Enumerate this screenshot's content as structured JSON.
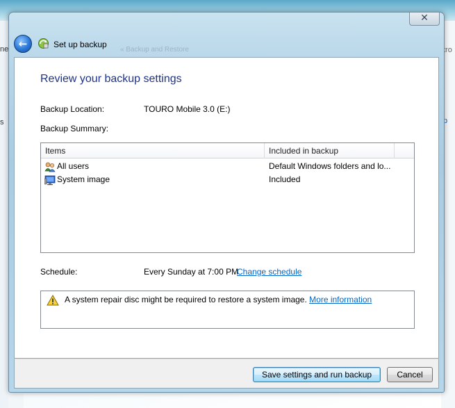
{
  "background": {
    "left_fragments": [
      "ne",
      "s"
    ],
    "right_fragments": [
      "tro",
      "p"
    ]
  },
  "window": {
    "close_glyph": "✕",
    "back_glyph": "←",
    "title": "Set up backup",
    "ghost_breadcrumb": "«  Backup and Restore"
  },
  "content": {
    "heading": "Review your backup settings",
    "backup_location_label": "Backup Location:",
    "backup_location_value": "TOURO Mobile 3.0 (E:)",
    "backup_summary_label": "Backup Summary:",
    "table": {
      "columns": [
        "Items",
        "Included in backup"
      ],
      "rows": [
        {
          "icon": "users-icon",
          "item": "All users",
          "included": "Default Windows folders and lo..."
        },
        {
          "icon": "system-image-icon",
          "item": "System image",
          "included": "Included"
        }
      ]
    },
    "schedule_label": "Schedule:",
    "schedule_value": "Every Sunday at 7:00 PM",
    "change_schedule_link": "Change schedule",
    "warning": {
      "icon": "warning-icon",
      "text": "A system repair disc might be required to restore a system image.",
      "link": "More information"
    }
  },
  "footer": {
    "save_button": "Save settings and run backup",
    "cancel_button": "Cancel"
  },
  "colors": {
    "heading": "#1e3287",
    "link": "#0066cc",
    "frame": "#a9cce2"
  }
}
